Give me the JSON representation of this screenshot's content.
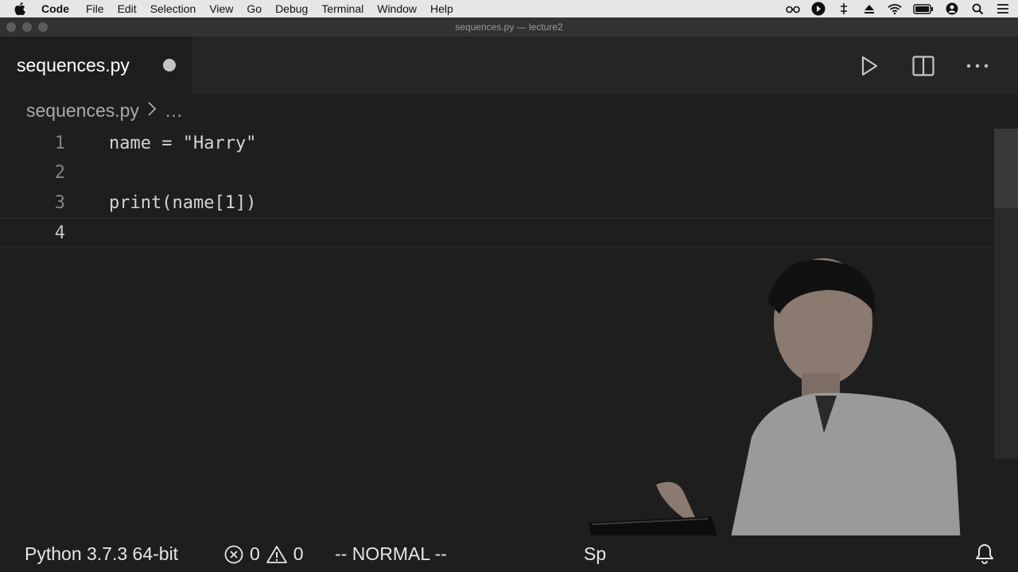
{
  "menubar": {
    "app_name": "Code",
    "items": [
      "File",
      "Edit",
      "Selection",
      "View",
      "Go",
      "Debug",
      "Terminal",
      "Window",
      "Help"
    ],
    "tray_icons": [
      "glasses-icon",
      "play-circle-icon",
      "move-icon",
      "eject-icon",
      "wifi-icon",
      "battery-icon",
      "user-icon",
      "search-icon",
      "list-icon"
    ]
  },
  "window": {
    "title": "sequences.py — lecture2"
  },
  "tab": {
    "label": "sequences.py",
    "unsaved": true
  },
  "breadcrumb": {
    "file": "sequences.py",
    "more": "…"
  },
  "editor": {
    "lines": [
      {
        "number": "1",
        "text": "name = \"Harry\""
      },
      {
        "number": "2",
        "text": ""
      },
      {
        "number": "3",
        "text": "print(name[1])"
      },
      {
        "number": "4",
        "text": ""
      }
    ],
    "current_line": 4
  },
  "statusbar": {
    "interpreter": "Python 3.7.3 64-bit",
    "errors": "0",
    "warnings": "0",
    "mode": "-- NORMAL --",
    "indent_partial": "Sp"
  },
  "colors": {
    "editor_bg": "#1e1e1e",
    "tab_bg": "#252526",
    "menubar_bg": "#e6e6e6"
  }
}
